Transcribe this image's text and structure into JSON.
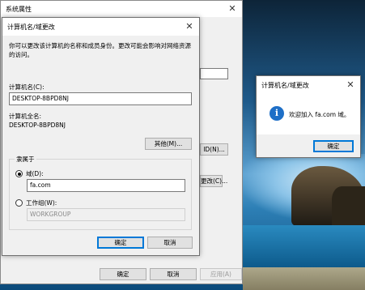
{
  "back_window": {
    "title": "系统属性",
    "ok_label": "确定",
    "cancel_label": "取消",
    "apply_label": "应用(A)",
    "change_button_label": "更改(C)...",
    "network_id_button_label": "ID(N)..."
  },
  "name_dialog": {
    "title": "计算机名/域更改",
    "description": "你可以更改该计算机的名称和成员身份。更改可能会影响对网络资源的访问。",
    "computer_name_label": "计算机名(C):",
    "computer_name_value": "DESKTOP-8BPD8NJ",
    "full_name_label": "计算机全名:",
    "full_name_value": "DESKTOP-8BPD8NJ",
    "more_button": "其他(M)...",
    "member_of_label": "隶属于",
    "domain_radio_label": "域(D):",
    "domain_value": "fa.com",
    "workgroup_radio_label": "工作组(W):",
    "workgroup_value": "WORKGROUP",
    "ok_label": "确定",
    "cancel_label": "取消"
  },
  "message_box": {
    "title": "计算机名/域更改",
    "message": "欢迎加入 fa.com 域。",
    "ok_label": "确定",
    "icon": "info-icon"
  },
  "colors": {
    "accent": "#0078d7",
    "info_icon": "#1e6fc7"
  }
}
